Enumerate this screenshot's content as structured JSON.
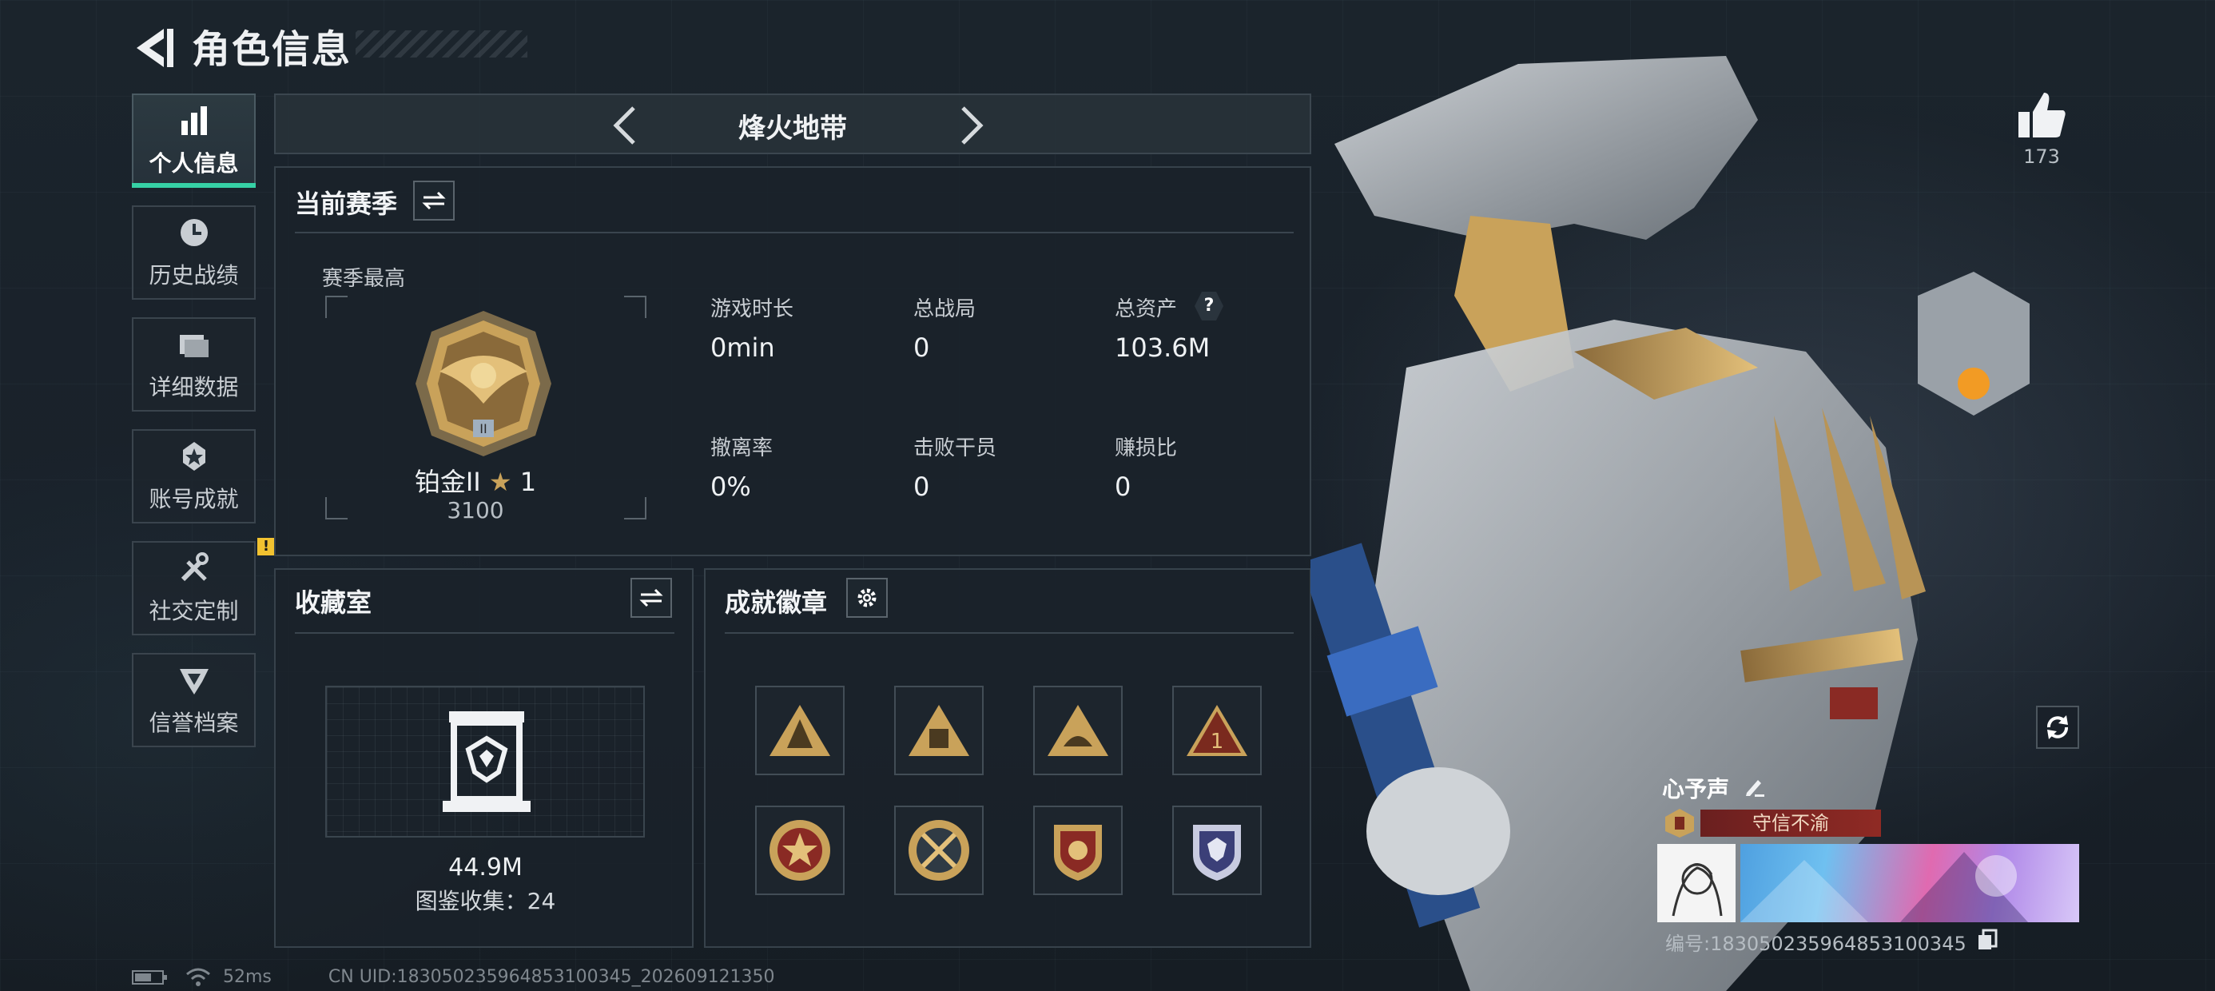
{
  "header": {
    "title": "角色信息"
  },
  "nav": {
    "items": [
      {
        "label": "个人信息",
        "icon": "bar-chart-icon"
      },
      {
        "label": "历史战绩",
        "icon": "history-clock-icon"
      },
      {
        "label": "详细数据",
        "icon": "folder-icon"
      },
      {
        "label": "账号成就",
        "icon": "achievement-icon"
      },
      {
        "label": "社交定制",
        "icon": "tools-icon"
      },
      {
        "label": "信誉档案",
        "icon": "credit-shield-icon"
      }
    ],
    "warning_badge": "!"
  },
  "mode_selector": {
    "label": "烽火地带"
  },
  "season": {
    "title": "当前赛季",
    "best_label": "赛季最高",
    "rank_name": "铂金II",
    "rank_stars": "1",
    "rank_score": "3100",
    "stats": [
      {
        "label": "游戏时长",
        "value": "0min"
      },
      {
        "label": "总战局",
        "value": "0"
      },
      {
        "label": "总资产",
        "value": "103.6M",
        "help": "?"
      },
      {
        "label": "撤离率",
        "value": "0%"
      },
      {
        "label": "击败干员",
        "value": "0"
      },
      {
        "label": "赚损比",
        "value": "0"
      }
    ]
  },
  "collection": {
    "title": "收藏室",
    "value": "44.9M",
    "count_text": "图鉴收集：24"
  },
  "badges": {
    "title": "成就徽章",
    "icons": [
      "triangle-badge-icon",
      "triangle-badge-icon",
      "triangle-badge-icon",
      "triangle-badge-icon",
      "round-badge-icon",
      "round-badge-icon",
      "shield-badge-icon",
      "shield-badge-icon"
    ]
  },
  "profile": {
    "likes": "173",
    "name": "心予声",
    "title_tag": "守信不渝",
    "id_text": "编号:18305023596485310034​5"
  },
  "status": {
    "latency": "52ms",
    "uid": "CN UID:183050235964853100345_202609121350"
  },
  "colors": {
    "accent": "#36d1a5",
    "warning": "#f2c230",
    "gold": "#c9a25a"
  }
}
